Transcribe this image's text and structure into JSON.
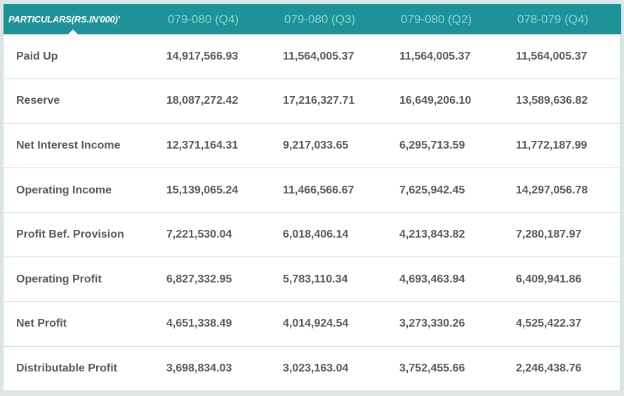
{
  "table": {
    "headers": [
      "PARTICULARS(RS.IN'000)'",
      "079-080 (Q4)",
      "079-080 (Q3)",
      "079-080 (Q2)",
      "078-079 (Q4)"
    ],
    "rows": [
      {
        "label": "Paid Up",
        "values": [
          "14,917,566.93",
          "11,564,005.37",
          "11,564,005.37",
          "11,564,005.37"
        ]
      },
      {
        "label": "Reserve",
        "values": [
          "18,087,272.42",
          "17,216,327.71",
          "16,649,206.10",
          "13,589,636.82"
        ]
      },
      {
        "label": "Net Interest Income",
        "values": [
          "12,371,164.31",
          "9,217,033.65",
          "6,295,713.59",
          "11,772,187.99"
        ]
      },
      {
        "label": "Operating Income",
        "values": [
          "15,139,065.24",
          "11,466,566.67",
          "7,625,942.45",
          "14,297,056.78"
        ]
      },
      {
        "label": "Profit Bef. Provision",
        "values": [
          "7,221,530.04",
          "6,018,406.14",
          "4,213,843.82",
          "7,280,187.97"
        ]
      },
      {
        "label": "Operating Profit",
        "values": [
          "6,827,332.95",
          "5,783,110.34",
          "4,693,463.94",
          "6,409,941.86"
        ]
      },
      {
        "label": "Net Profit",
        "values": [
          "4,651,338.49",
          "4,014,924.54",
          "3,273,330.26",
          "4,525,422.37"
        ]
      },
      {
        "label": "Distributable Profit",
        "values": [
          "3,698,834.03",
          "3,023,163.04",
          "3,752,455.66",
          "2,246,438.76"
        ]
      }
    ]
  },
  "colors": {
    "header_bg": "#1e9298",
    "header_text": "#8fd4d6",
    "header_first_text": "#ffffff",
    "cell_text": "#555a5c",
    "row_divider": "#c9dddd"
  }
}
